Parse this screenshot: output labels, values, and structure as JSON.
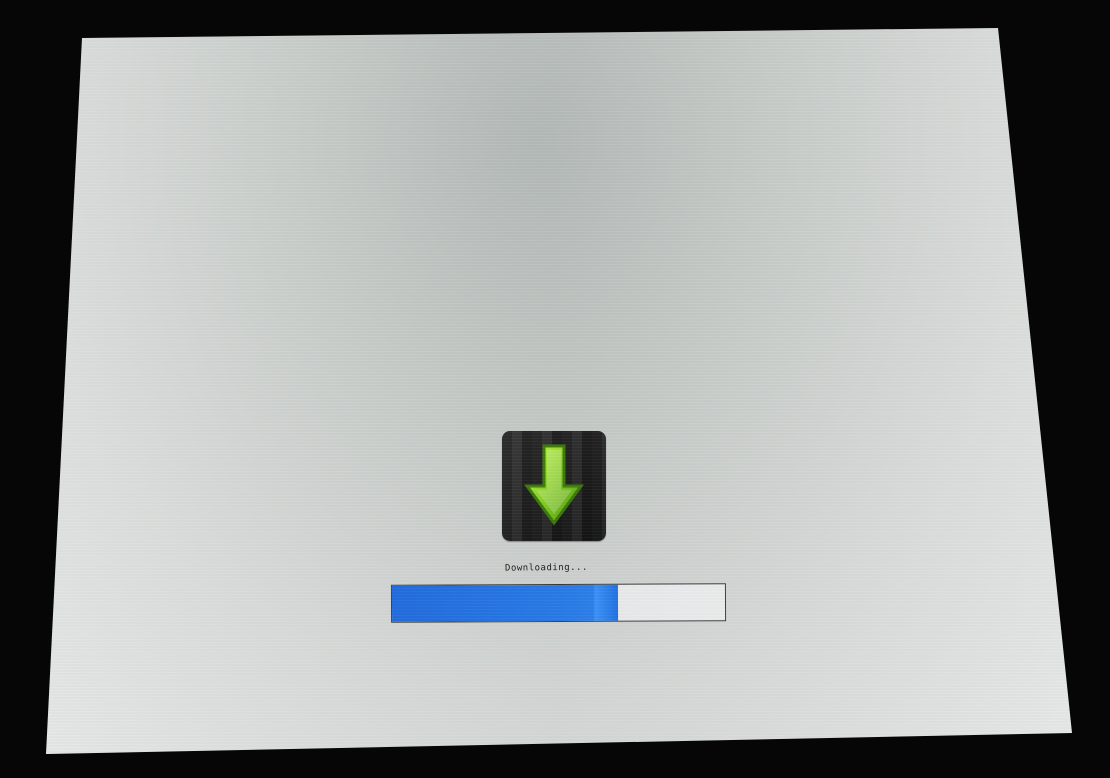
{
  "status": {
    "text": "Downloading..."
  },
  "progress": {
    "percent": 68
  },
  "icons": {
    "download": "download-arrow-icon"
  },
  "colors": {
    "screen": "#d9dcda",
    "progress": "#2d82f0",
    "arrow": "#8ccf20",
    "icon_tile": "#1b1b1b"
  }
}
